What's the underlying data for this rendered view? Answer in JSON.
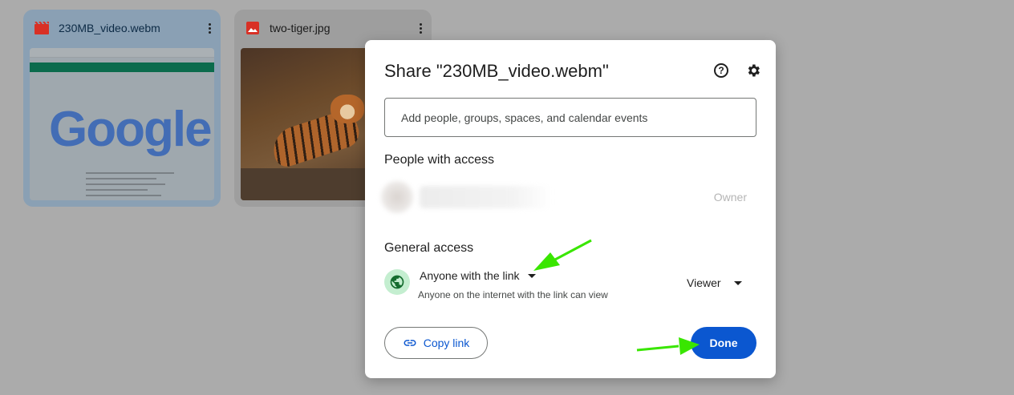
{
  "files": [
    {
      "name": "230MB_video.webm",
      "icon": "video-file-icon",
      "icon_color": "#d93025"
    },
    {
      "name": "two-tiger.jpg",
      "icon": "image-file-icon",
      "icon_color": "#d93025"
    }
  ],
  "thumbnail": {
    "google_logo": "Google"
  },
  "dialog": {
    "title": "Share \"230MB_video.webm\"",
    "help_icon": "help-icon",
    "settings_icon": "gear-icon",
    "add_people_placeholder": "Add people, groups, spaces, and calendar events",
    "people_heading": "People with access",
    "owner_role": "Owner",
    "general_heading": "General access",
    "access_level": "Anyone with the link",
    "access_description": "Anyone on the internet with the link can view",
    "role": "Viewer",
    "copy_link_label": "Copy link",
    "done_label": "Done"
  },
  "colors": {
    "primary": "#0b57d0",
    "globe_bg": "#c4eed0",
    "globe": "#146c2e",
    "annotation_arrow": "#39e600"
  }
}
